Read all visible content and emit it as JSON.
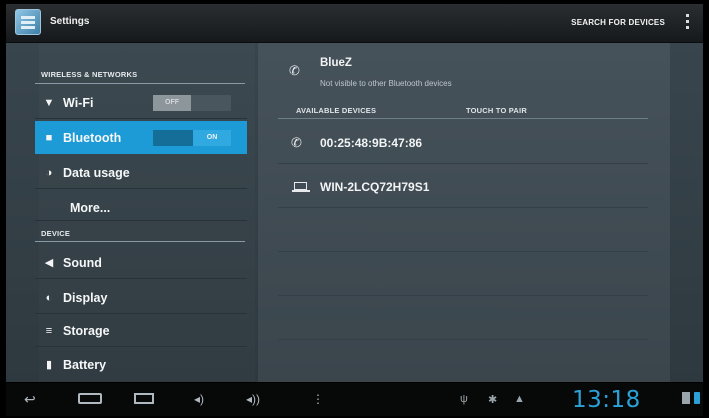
{
  "actionbar": {
    "title": "Settings",
    "search_label": "SEARCH FOR DEVICES"
  },
  "sidebar": {
    "sections": [
      {
        "header": "WIRELESS & NETWORKS"
      },
      {
        "header": "DEVICE"
      }
    ],
    "items": [
      {
        "label": "Wi-Fi",
        "icon": "wifi-icon",
        "toggle": "OFF",
        "selected": false
      },
      {
        "label": "Bluetooth",
        "icon": "bluetooth-icon",
        "toggle": "ON",
        "selected": true
      },
      {
        "label": "Data usage",
        "icon": "data-usage-icon",
        "selected": false
      },
      {
        "label": "More...",
        "selected": false
      },
      {
        "label": "Sound",
        "icon": "speaker-icon",
        "selected": false
      },
      {
        "label": "Display",
        "icon": "brightness-icon",
        "selected": false
      },
      {
        "label": "Storage",
        "icon": "storage-icon",
        "selected": false
      },
      {
        "label": "Battery",
        "icon": "battery-icon",
        "selected": false
      }
    ]
  },
  "bluetooth": {
    "device_name": "BlueZ",
    "device_status": "Not visible to other Bluetooth devices",
    "available_header": "AVAILABLE DEVICES",
    "touch_header": "TOUCH TO PAIR",
    "devices": [
      {
        "name": "00:25:48:9B:47:86",
        "icon": "phone-icon"
      },
      {
        "name": "WIN-2LCQ72H79S1",
        "icon": "laptop-icon"
      }
    ]
  },
  "systembar": {
    "clock": "13:18"
  },
  "colors": {
    "accent": "#1d9bd6",
    "clock": "#2aa2d8"
  }
}
